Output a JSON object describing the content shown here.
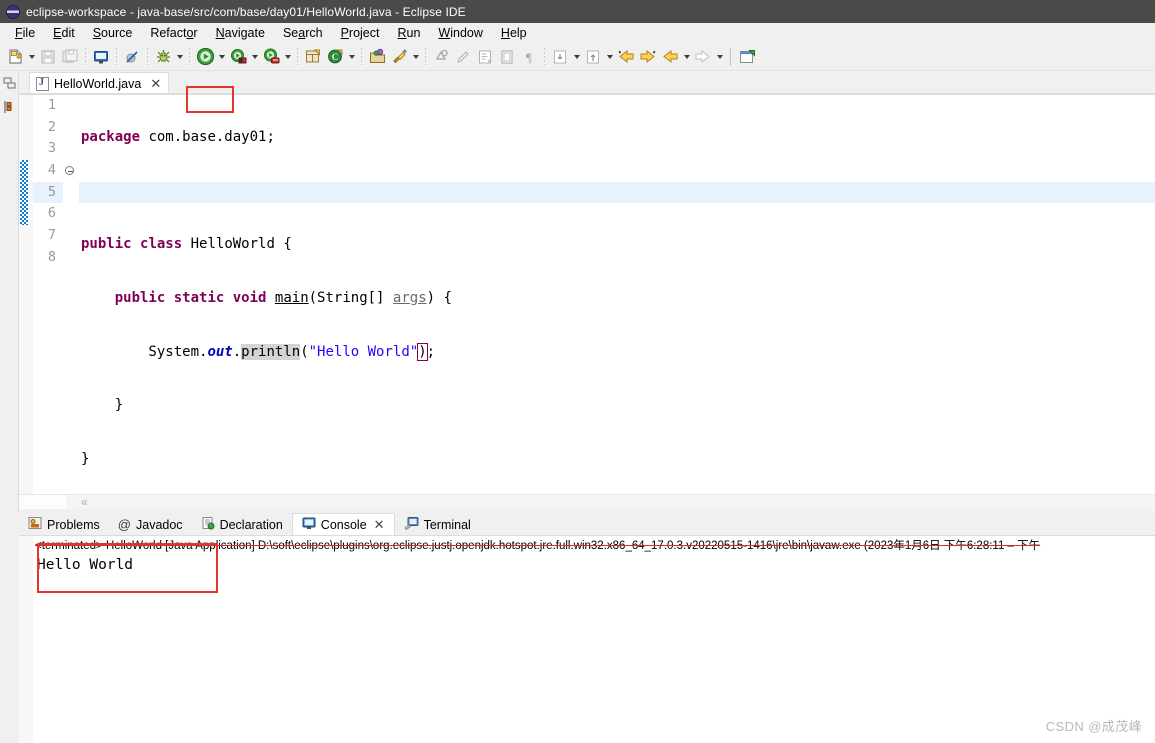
{
  "window": {
    "title": "eclipse-workspace - java-base/src/com/base/day01/HelloWorld.java - Eclipse IDE",
    "logo_icon": "eclipse-logo-icon"
  },
  "menubar": {
    "items": [
      {
        "label": "File",
        "mnemonic": "F"
      },
      {
        "label": "Edit",
        "mnemonic": "E"
      },
      {
        "label": "Source",
        "mnemonic": "S"
      },
      {
        "label": "Refactor",
        "mnemonic": "o"
      },
      {
        "label": "Navigate",
        "mnemonic": "N"
      },
      {
        "label": "Search",
        "mnemonic": "a"
      },
      {
        "label": "Project",
        "mnemonic": "P"
      },
      {
        "label": "Run",
        "mnemonic": "R"
      },
      {
        "label": "Window",
        "mnemonic": "W"
      },
      {
        "label": "Help",
        "mnemonic": "H"
      }
    ]
  },
  "toolbar": {
    "buttons": [
      {
        "name": "new-icon",
        "tooltip": "New"
      },
      {
        "name": "save-icon",
        "tooltip": "Save"
      },
      {
        "name": "save-all-icon",
        "tooltip": "Save All"
      },
      {
        "name": "new-console-view-icon",
        "tooltip": "Open Console"
      },
      {
        "name": "toggle-breakpoint-icon",
        "tooltip": "Skip All Breakpoints"
      },
      {
        "name": "debug-icon",
        "tooltip": "Debug"
      },
      {
        "name": "run-icon",
        "tooltip": "Run"
      },
      {
        "name": "coverage-icon",
        "tooltip": "Coverage"
      },
      {
        "name": "external-tools-icon",
        "tooltip": "External Tools"
      },
      {
        "name": "new-java-project-icon",
        "tooltip": "New Java Project"
      },
      {
        "name": "new-class-icon",
        "tooltip": "New Java Class"
      },
      {
        "name": "open-type-icon",
        "tooltip": "Open Type"
      },
      {
        "name": "search-icon",
        "tooltip": "Search"
      },
      {
        "name": "toggle-mark-occurrences-icon",
        "tooltip": "Toggle Mark Occurrences"
      },
      {
        "name": "pencil-icon",
        "tooltip": "Annotate"
      },
      {
        "name": "show-whitespace-icon",
        "tooltip": "Show Whitespace Characters"
      },
      {
        "name": "block-selection-icon",
        "tooltip": "Toggle Block Selection"
      },
      {
        "name": "pilcrow-icon",
        "tooltip": "Show Print Margin"
      },
      {
        "name": "next-annotation-icon",
        "tooltip": "Next Annotation"
      },
      {
        "name": "previous-annotation-icon",
        "tooltip": "Previous Annotation"
      },
      {
        "name": "back-to-edit-icon",
        "tooltip": "Last Edit Location"
      },
      {
        "name": "forward-edit-icon",
        "tooltip": "Next Edit Location"
      },
      {
        "name": "back-icon",
        "tooltip": "Back"
      },
      {
        "name": "forward-icon",
        "tooltip": "Forward"
      },
      {
        "name": "new-window-icon",
        "tooltip": "New Editor"
      }
    ],
    "run_highlight_color": "#e8332a"
  },
  "left_minimized_bar": {
    "items": [
      {
        "name": "restore-package-explorer-icon",
        "label": "Package Explorer"
      },
      {
        "name": "restore-outline-icon",
        "label": "Outline"
      }
    ]
  },
  "editor": {
    "tab": {
      "label": "HelloWorld.java",
      "icon": "java-file-icon",
      "close_label": "✕",
      "active": true
    },
    "line_numbers": [
      "1",
      "2",
      "3",
      "4",
      "5",
      "6",
      "7",
      "8"
    ],
    "highlighted_line": 5,
    "folding_marker_line": 4,
    "code_lines": [
      "package com.base.day01;",
      "",
      "public class HelloWorld {",
      "    public static void main(String[] args) {",
      "        System.out.println(\"Hello World\");",
      "    }",
      "}",
      ""
    ],
    "tokens": {
      "keywords": [
        "package",
        "public",
        "class",
        "static",
        "void"
      ],
      "string_literal": "\"Hello World\"",
      "field": "out",
      "method": "main",
      "occurrence_highlight": "println",
      "local_variable": "args",
      "type_name": "HelloWorld"
    },
    "colors": {
      "keyword": "#7f0055",
      "string": "#2a00ff",
      "field": "#0000c0",
      "current_line": "#e8f2fe",
      "occurrence": "#d4d4d4",
      "change_bar": "#0c7fd4"
    },
    "hscrollbar": {
      "chevron": "«"
    }
  },
  "bottom_panel": {
    "tabs": [
      {
        "label": "Problems",
        "icon": "problems-icon",
        "active": false
      },
      {
        "label": "Javadoc",
        "icon": "javadoc-at-icon",
        "active": false
      },
      {
        "label": "Declaration",
        "icon": "declaration-icon",
        "active": false
      },
      {
        "label": "Console",
        "icon": "console-icon",
        "active": true,
        "closable": true,
        "close_label": "✕"
      },
      {
        "label": "Terminal",
        "icon": "terminal-icon",
        "active": false
      }
    ],
    "console": {
      "launch_line": "<terminated> HelloWorld [Java Application] D:\\soft\\eclipse\\plugins\\org.eclipse.justj.openjdk.hotspot.jre.full.win32.x86_64_17.0.3.v20220515-1416\\jre\\bin\\javaw.exe  (2023年1月6日 下午6:28:11 – 下午",
      "output": "Hello World",
      "output_highlight_color": "#e8332a"
    }
  },
  "watermark": {
    "text": "CSDN @成茂峰"
  }
}
